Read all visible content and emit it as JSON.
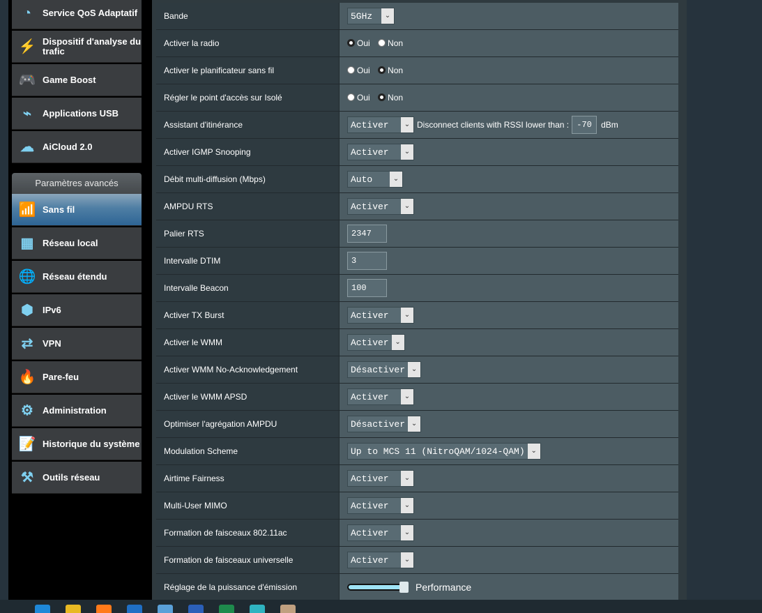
{
  "sidebar": {
    "items": [
      {
        "label": "Service QoS Adaptatif",
        "icon": "speedometer-icon"
      },
      {
        "label": "Dispositif d'analyse du trafic",
        "icon": "traffic-analyzer-icon"
      },
      {
        "label": "Game Boost",
        "icon": "gamepad-icon"
      },
      {
        "label": "Applications USB",
        "icon": "usb-icon"
      },
      {
        "label": "AiCloud 2.0",
        "icon": "cloud-icon"
      }
    ],
    "advanced_header": "Paramètres avancés",
    "advanced": [
      {
        "label": "Sans fil",
        "icon": "wifi-icon",
        "active": true
      },
      {
        "label": "Réseau local",
        "icon": "lan-icon"
      },
      {
        "label": "Réseau étendu",
        "icon": "globe-icon"
      },
      {
        "label": "IPv6",
        "icon": "ipv6-icon"
      },
      {
        "label": "VPN",
        "icon": "vpn-icon"
      },
      {
        "label": "Pare-feu",
        "icon": "firewall-icon"
      },
      {
        "label": "Administration",
        "icon": "gear-icon"
      },
      {
        "label": "Historique du système",
        "icon": "log-icon"
      },
      {
        "label": "Outils réseau",
        "icon": "tools-icon"
      }
    ]
  },
  "radio": {
    "yes": "Oui",
    "no": "Non"
  },
  "roaming": {
    "text": "Disconnect clients with RSSI lower than :",
    "value": "-70",
    "unit": "dBm"
  },
  "power": {
    "label": "Performance",
    "level": 1.0
  },
  "rows": [
    {
      "label": "Bande",
      "type": "select",
      "value": "5GHz"
    },
    {
      "label": "Activer la radio",
      "type": "radio",
      "selected": "yes"
    },
    {
      "label": "Activer le planificateur sans fil",
      "type": "radio",
      "selected": "no"
    },
    {
      "label": "Régler le point d'accès sur Isolé",
      "type": "radio",
      "selected": "no"
    },
    {
      "label": "Assistant d'itinérance",
      "type": "roaming",
      "value": "Activer"
    },
    {
      "label": "Activer IGMP Snooping",
      "type": "select",
      "value": "Activer"
    },
    {
      "label": "Débit multi-diffusion (Mbps)",
      "type": "select",
      "value": "Auto"
    },
    {
      "label": "AMPDU RTS",
      "type": "select",
      "value": "Activer"
    },
    {
      "label": "Palier RTS",
      "type": "input",
      "value": "2347"
    },
    {
      "label": "Intervalle DTIM",
      "type": "input",
      "value": "3"
    },
    {
      "label": "Intervalle Beacon",
      "type": "input",
      "value": "100"
    },
    {
      "label": "Activer TX Burst",
      "type": "select",
      "value": "Activer"
    },
    {
      "label": "Activer le WMM",
      "type": "select",
      "value": "Activer"
    },
    {
      "label": "Activer WMM No-Acknowledgement",
      "type": "select",
      "value": "Désactiver"
    },
    {
      "label": "Activer le WMM APSD",
      "type": "select",
      "value": "Activer"
    },
    {
      "label": "Optimiser l'agrégation AMPDU",
      "type": "select",
      "value": "Désactiver"
    },
    {
      "label": "Modulation Scheme",
      "type": "select",
      "value": "Up to MCS 11 (NitroQAM/1024-QAM)"
    },
    {
      "label": "Airtime Fairness",
      "type": "select",
      "value": "Activer"
    },
    {
      "label": "Multi-User MIMO",
      "type": "select",
      "value": "Activer"
    },
    {
      "label": "Formation de faisceaux 802.11ac",
      "type": "select",
      "value": "Activer"
    },
    {
      "label": "Formation de faisceaux universelle",
      "type": "select",
      "value": "Activer"
    },
    {
      "label": "Réglage de la puissance d'émission",
      "type": "slider"
    }
  ],
  "taskbar": {
    "icons": [
      "edge-icon",
      "explorer-icon",
      "firefox-icon",
      "outlook-icon",
      "photos-icon",
      "word-icon",
      "excel-icon",
      "app-icon",
      "paint-icon"
    ],
    "colors": [
      "#1e88d8",
      "#e8b923",
      "#ff7a1a",
      "#1f6fc5",
      "#5aa0d8",
      "#2b5fb8",
      "#1e8a4c",
      "#2fb3c0",
      "#c0a080"
    ]
  }
}
